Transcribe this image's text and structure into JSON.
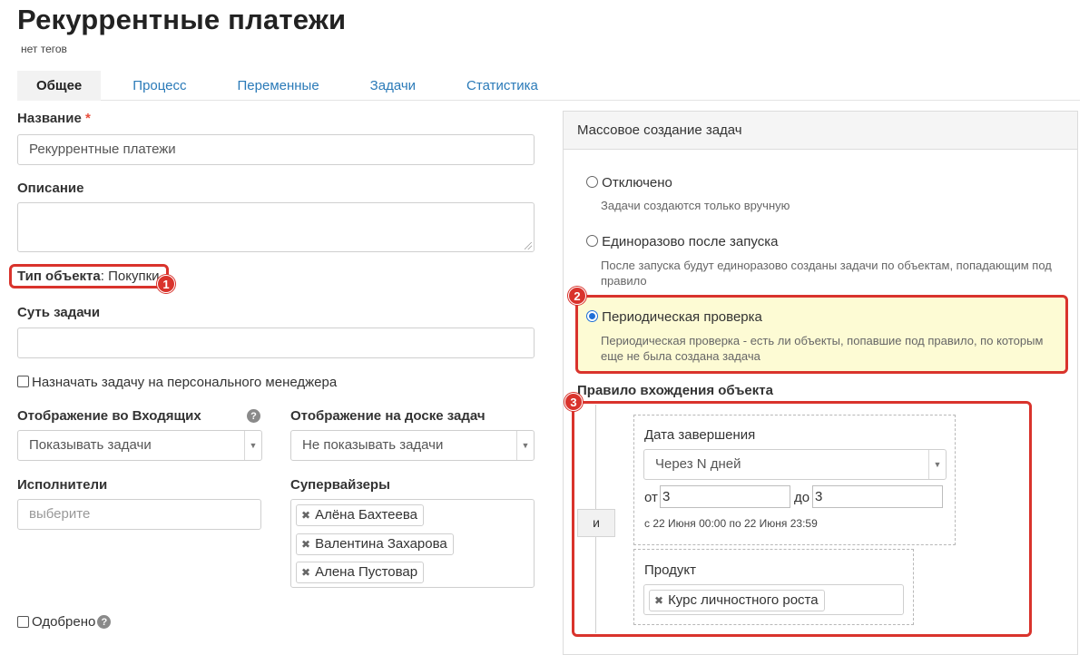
{
  "page": {
    "title": "Рекуррентные платежи",
    "tags": "нет тегов"
  },
  "tabs": [
    {
      "label": "Общее",
      "active": true
    },
    {
      "label": "Процесс",
      "active": false
    },
    {
      "label": "Переменные",
      "active": false
    },
    {
      "label": "Задачи",
      "active": false
    },
    {
      "label": "Статистика",
      "active": false
    }
  ],
  "form": {
    "name_label": "Название",
    "required_mark": "*",
    "name_value": "Рекуррентные платежи",
    "description_label": "Описание",
    "description_value": "",
    "object_type_label": "Тип объекта",
    "object_type_sep": ":",
    "object_type_value": "Покупки",
    "task_essence_label": "Суть задачи",
    "task_essence_value": "",
    "assign_manager_label": "Назначать задачу на персонального менеджера",
    "inbox_display_label": "Отображение во Входящих",
    "inbox_display_value": "Показывать задачи",
    "board_display_label": "Отображение на доске задач",
    "board_display_value": "Не показывать задачи",
    "executors_label": "Исполнители",
    "executors_placeholder": "выберите",
    "supervisors_label": "Супервайзеры",
    "supervisors": [
      "Алёна Бахтеева",
      "Валентина Захарова",
      "Алена Пустовар"
    ],
    "approved_label": "Одобрено"
  },
  "mass_creation": {
    "header": "Массовое создание задач",
    "options": [
      {
        "title": "Отключено",
        "desc": "Задачи создаются только вручную",
        "selected": false
      },
      {
        "title": "Единоразово после запуска",
        "desc": "После запуска будут единоразово созданы задачи по объектам, попадающим под правило",
        "selected": false
      },
      {
        "title": "Периодическая проверка",
        "desc": "Периодическая проверка - есть ли объекты, попавшие под правило, по которым еще не была создана задача",
        "selected": true
      }
    ],
    "rule_label": "Правило вхождения объекта",
    "and_label": "и",
    "end_date": {
      "label": "Дата завершения",
      "select_value": "Через N дней",
      "from_label": "от",
      "from_value": "3",
      "to_label": "до",
      "to_value": "3",
      "range_text": "с 22 Июня 00:00 по 22 Июня 23:59"
    },
    "product": {
      "label": "Продукт",
      "tags": [
        "Курс личностного роста"
      ]
    }
  },
  "callouts": [
    "1",
    "2",
    "3"
  ],
  "colors": {
    "accent_link": "#2a7ab8",
    "highlight_bg": "#fdfbd4",
    "callout_red": "#d9332c",
    "radio_blue": "#1f6fd6"
  },
  "icons": {
    "help": "help-circle-icon",
    "remove": "close-x-icon",
    "caret": "chevron-down-icon"
  }
}
